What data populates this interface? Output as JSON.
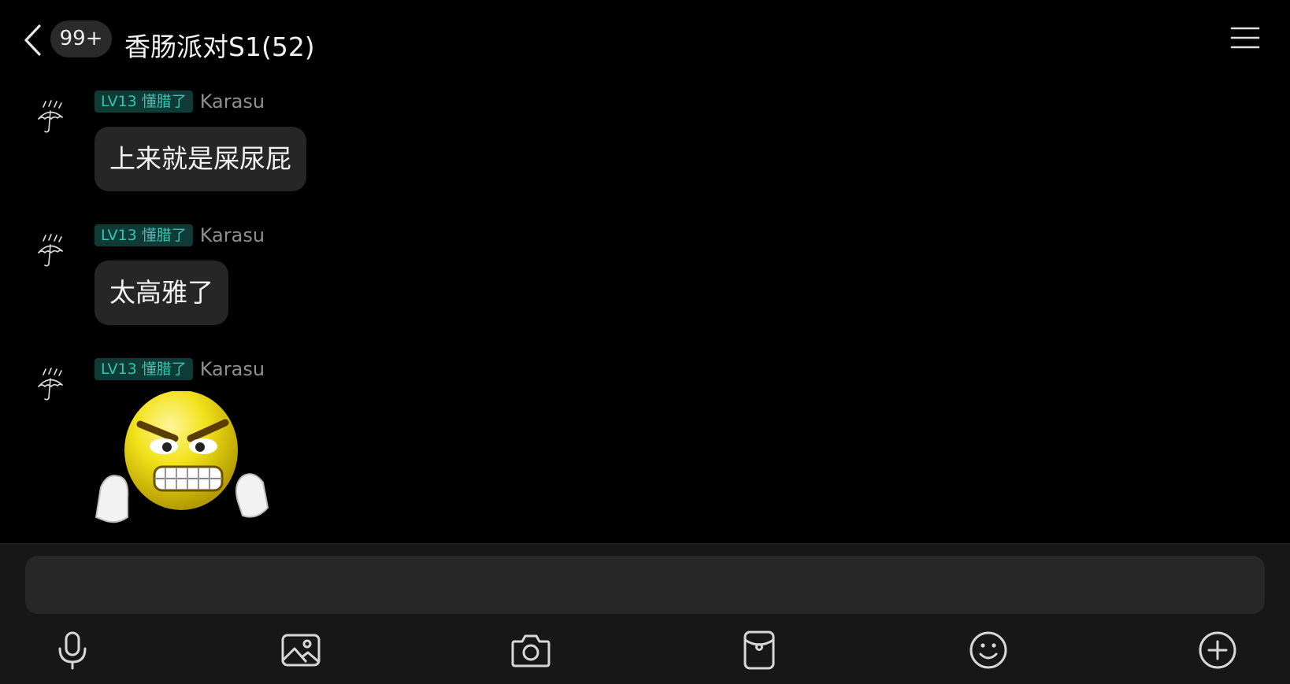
{
  "header": {
    "unread_count": "99+",
    "title": "香肠派对S1(52)",
    "back_icon": "chevron-left-icon",
    "menu_icon": "hamburger-menu-icon"
  },
  "messages": [
    {
      "level": "LV13 懂腊了",
      "sender": "Karasu",
      "text": "上来就是屎尿屁",
      "avatar_icon": "umbrella-rain-icon"
    },
    {
      "level": "LV13 懂腊了",
      "sender": "Karasu",
      "text": "太高雅了",
      "avatar_icon": "umbrella-rain-icon"
    },
    {
      "level": "LV13 懂腊了",
      "sender": "Karasu",
      "sticker": "angry-emoji-sticker",
      "avatar_icon": "umbrella-rain-icon"
    }
  ],
  "composer": {
    "placeholder": "",
    "tools": [
      "microphone-icon",
      "image-icon",
      "camera-icon",
      "red-packet-icon",
      "emoji-icon",
      "plus-icon"
    ]
  },
  "colors": {
    "background": "#000000",
    "bubble": "#262626",
    "level_badge_bg": "#0f3a35",
    "level_badge_text": "#2fc7b2",
    "composer_bg": "#171717"
  }
}
